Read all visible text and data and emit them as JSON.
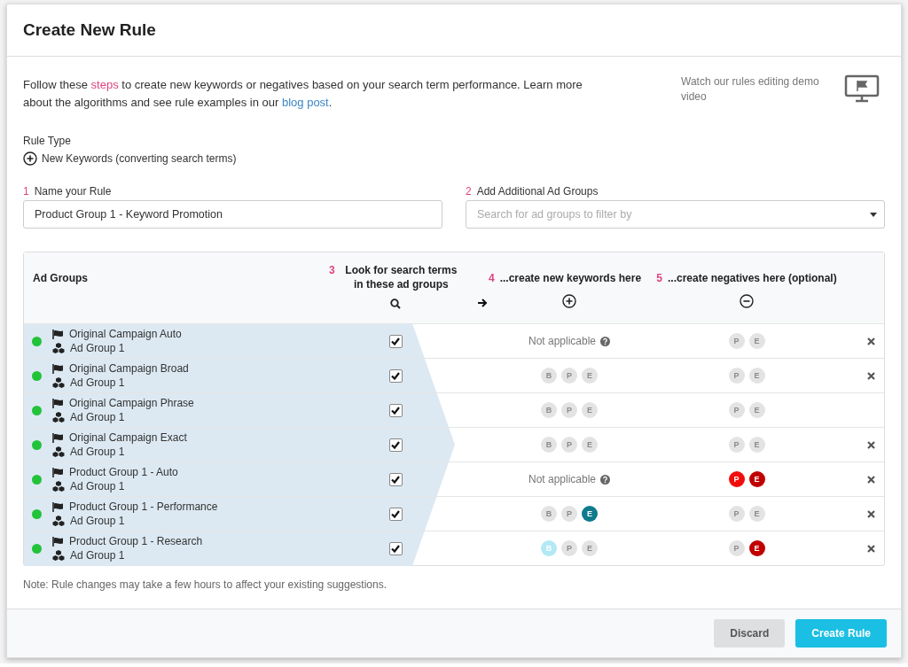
{
  "dialog": {
    "title": "Create New Rule"
  },
  "intro": {
    "text": "Follow these **steps** to create new keywords or negatives based on your search term performance. Learn more about the algorithms and see rule examples in our",
    "link": "blog post",
    "end": "."
  },
  "video": {
    "text": "Watch our rules editing demo video"
  },
  "rule_type": {
    "label": "Rule Type",
    "value": "New Keywords (converting search terms)"
  },
  "name_field": {
    "step": "1",
    "label": "Name your Rule",
    "value": "Product Group 1 - Keyword Promotion"
  },
  "groups_field": {
    "step": "2",
    "label": "Add Additional Ad Groups",
    "placeholder": "Search for ad groups to filter by"
  },
  "table": {
    "columns": [
      {
        "kind": "plain",
        "label": "Ad Groups"
      },
      {
        "kind": "step",
        "step": "3",
        "label": "Look for search terms in these ad groups"
      },
      {
        "kind": "step",
        "step": "4",
        "label": "...create new keywords here"
      },
      {
        "kind": "step",
        "step": "5",
        "label": "...create negatives here (optional)"
      }
    ],
    "rows": [
      {
        "campaign": "Original Campaign Auto",
        "ad_group": "Ad Group 1",
        "color": "#22c33a",
        "checked": true,
        "keywords": {
          "kind": "note",
          "text": "Not applicable"
        },
        "negatives": [
          {
            "label": "P",
            "on": false
          },
          {
            "label": "E",
            "on": false
          }
        ],
        "removable": true
      },
      {
        "campaign": "Original Campaign Broad",
        "ad_group": "Ad Group 1",
        "color": "#22c33a",
        "checked": true,
        "keywords": {
          "kind": "badges",
          "badges": [
            {
              "label": "B",
              "on": false
            },
            {
              "label": "P",
              "on": false
            },
            {
              "label": "E",
              "on": false
            }
          ]
        },
        "negatives": [
          {
            "label": "P",
            "on": false
          },
          {
            "label": "E",
            "on": false
          }
        ],
        "removable": true
      },
      {
        "campaign": "Original Campaign Phrase",
        "ad_group": "Ad Group 1",
        "color": "#22c33a",
        "checked": true,
        "keywords": {
          "kind": "badges",
          "badges": [
            {
              "label": "B",
              "on": false
            },
            {
              "label": "P",
              "on": false
            },
            {
              "label": "E",
              "on": false
            }
          ]
        },
        "negatives": [
          {
            "label": "P",
            "on": false
          },
          {
            "label": "E",
            "on": false
          }
        ],
        "removable": false
      },
      {
        "campaign": "Original Campaign Exact",
        "ad_group": "Ad Group 1",
        "color": "#22c33a",
        "checked": true,
        "keywords": {
          "kind": "badges",
          "badges": [
            {
              "label": "B",
              "on": false
            },
            {
              "label": "P",
              "on": false
            },
            {
              "label": "E",
              "on": false
            }
          ]
        },
        "negatives": [
          {
            "label": "P",
            "on": false
          },
          {
            "label": "E",
            "on": false
          }
        ],
        "removable": true
      },
      {
        "campaign": "Product Group 1 - Auto",
        "ad_group": "Ad Group 1",
        "color": "#22c33a",
        "checked": true,
        "keywords": {
          "kind": "note",
          "text": "Not applicable"
        },
        "negatives": [
          {
            "label": "P",
            "on": true,
            "color": "#f20d0d"
          },
          {
            "label": "E",
            "on": true,
            "color": "#c00000"
          }
        ],
        "removable": true
      },
      {
        "campaign": "Product Group 1 - Performance",
        "ad_group": "Ad Group 1",
        "color": "#22c33a",
        "checked": true,
        "keywords": {
          "kind": "badges",
          "badges": [
            {
              "label": "B",
              "on": false
            },
            {
              "label": "P",
              "on": false
            },
            {
              "label": "E",
              "on": true,
              "color": "#0e7b8c"
            }
          ]
        },
        "negatives": [
          {
            "label": "P",
            "on": false
          },
          {
            "label": "E",
            "on": false
          }
        ],
        "removable": true
      },
      {
        "campaign": "Product Group 1 - Research",
        "ad_group": "Ad Group 1",
        "color": "#22c33a",
        "checked": true,
        "keywords": {
          "kind": "badges",
          "badges": [
            {
              "label": "B",
              "on": true,
              "color": "#b3e9f5"
            },
            {
              "label": "P",
              "on": false
            },
            {
              "label": "E",
              "on": false
            }
          ]
        },
        "negatives": [
          {
            "label": "P",
            "on": false
          },
          {
            "label": "E",
            "on": true,
            "color": "#c00000"
          }
        ],
        "removable": true
      }
    ]
  },
  "note": "Note: Rule changes may take a few hours to affect your existing suggestions.",
  "buttons": [
    {
      "kind": "secondary",
      "label": "Discard"
    },
    {
      "kind": "primary",
      "label": "Create Rule"
    }
  ]
}
